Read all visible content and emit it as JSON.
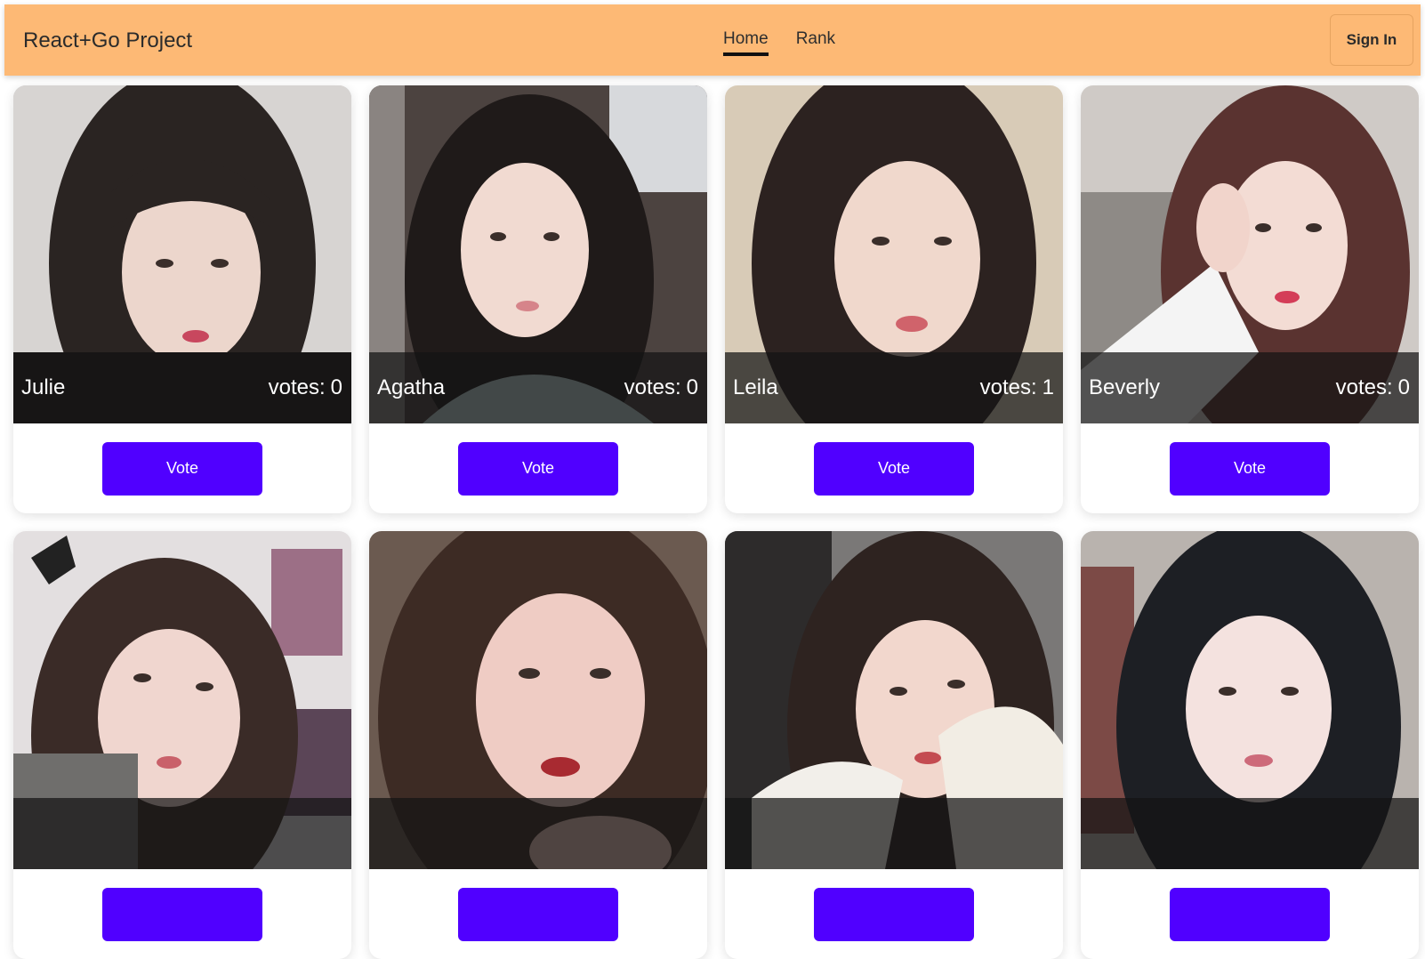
{
  "navbar": {
    "brand": "React+Go Project",
    "links": [
      {
        "label": "Home",
        "active": true
      },
      {
        "label": "Rank",
        "active": false
      }
    ],
    "signin_label": "Sign In",
    "background": "#fdb975"
  },
  "cards": [
    {
      "name": "Julie",
      "votes_label": "votes:",
      "votes": 0,
      "vote_label": "Vote"
    },
    {
      "name": "Agatha",
      "votes_label": "votes:",
      "votes": 0,
      "vote_label": "Vote"
    },
    {
      "name": "Leila",
      "votes_label": "votes:",
      "votes": 1,
      "vote_label": "Vote"
    },
    {
      "name": "Beverly",
      "votes_label": "votes:",
      "votes": 0,
      "vote_label": "Vote"
    },
    {
      "name": "",
      "votes_label": "",
      "votes": null,
      "vote_label": ""
    },
    {
      "name": "",
      "votes_label": "",
      "votes": null,
      "vote_label": ""
    },
    {
      "name": "",
      "votes_label": "",
      "votes": null,
      "vote_label": ""
    },
    {
      "name": "",
      "votes_label": "",
      "votes": null,
      "vote_label": ""
    }
  ],
  "colors": {
    "vote_button": "#5000ff",
    "overlay": "rgba(20,20,20,0.72)"
  }
}
